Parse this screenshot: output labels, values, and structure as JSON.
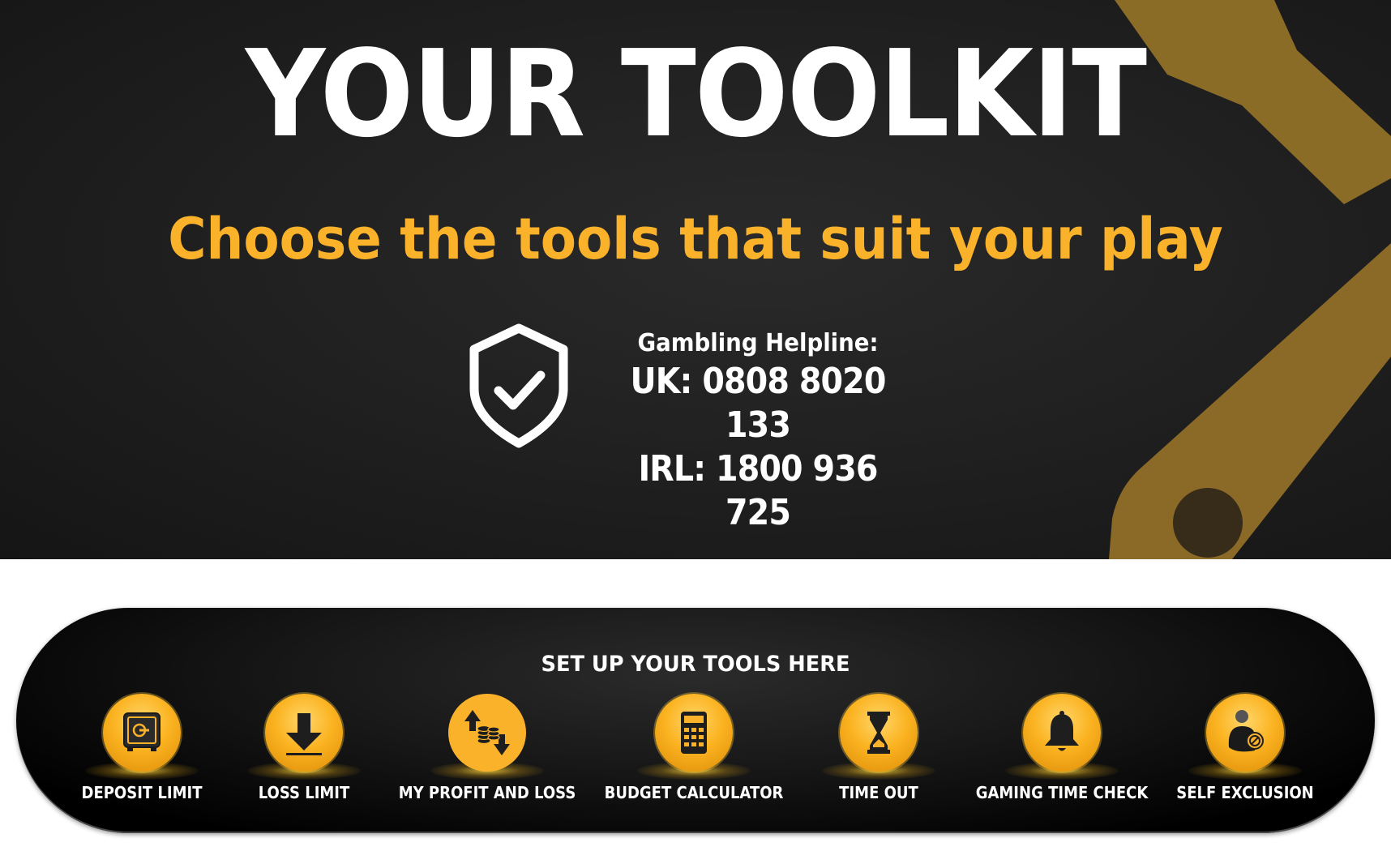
{
  "hero": {
    "title": "YOUR TOOLKIT",
    "subtitle": "Choose the tools that suit your play",
    "helpline": {
      "icon": "shield-check-icon",
      "label": "Gambling Helpline:",
      "uk": "UK: 0808 8020 133",
      "irl": "IRL: 1800 936 725"
    },
    "decoration": "wrench-icon"
  },
  "panel": {
    "title": "SET UP YOUR TOOLS HERE",
    "tools": [
      {
        "label": "DEPOSIT LIMIT",
        "icon": "safe-icon"
      },
      {
        "label": "LOSS LIMIT",
        "icon": "down-arrow-icon"
      },
      {
        "label": "MY PROFIT AND LOSS",
        "icon": "profit-loss-coins-icon"
      },
      {
        "label": "BUDGET CALCULATOR",
        "icon": "calculator-icon"
      },
      {
        "label": "TIME OUT",
        "icon": "hourglass-icon"
      },
      {
        "label": "GAMING TIME CHECK",
        "icon": "bell-icon"
      },
      {
        "label": "SELF EXCLUSION",
        "icon": "user-blocked-icon"
      }
    ]
  },
  "colors": {
    "accent": "#fbb22b",
    "hero_bg": "#222222",
    "wrench": "#8c6a26",
    "text": "#ffffff"
  }
}
